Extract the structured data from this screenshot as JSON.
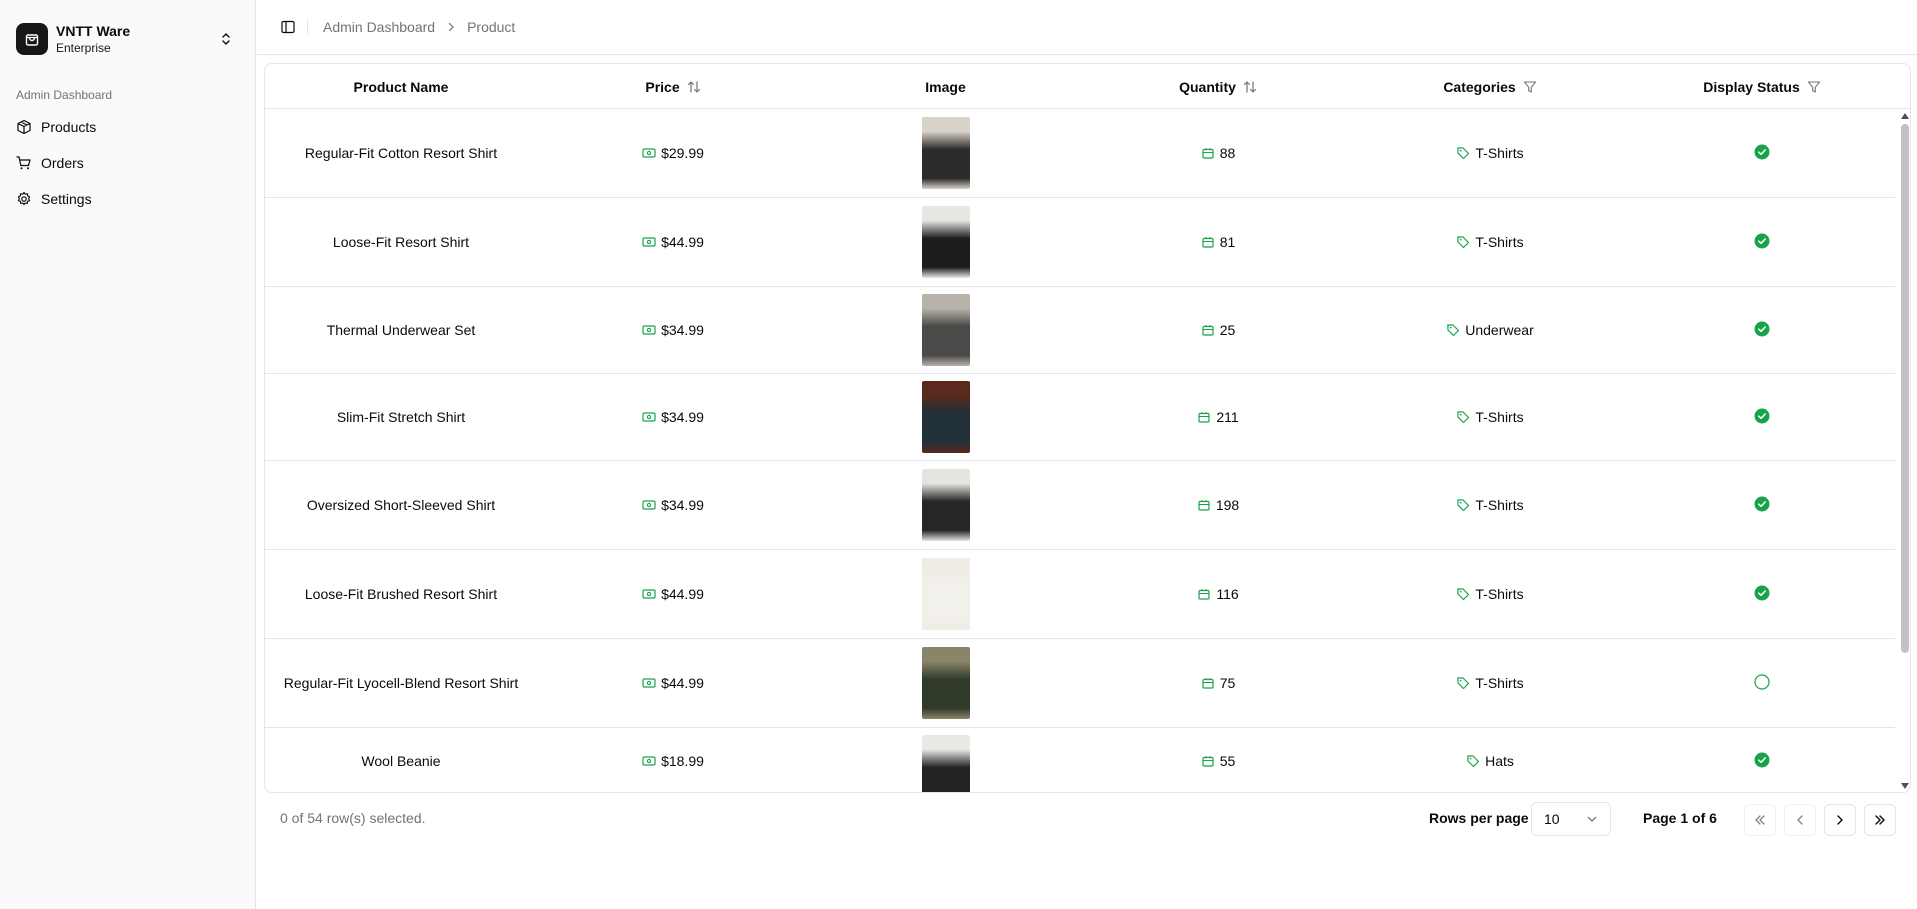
{
  "team": {
    "name": "VNTT Ware",
    "plan": "Enterprise"
  },
  "sidebar": {
    "group_label": "Admin Dashboard",
    "items": [
      {
        "label": "Products",
        "icon": "package-icon"
      },
      {
        "label": "Orders",
        "icon": "shopping-cart-icon"
      },
      {
        "label": "Settings",
        "icon": "gear-icon"
      }
    ]
  },
  "breadcrumb": {
    "root": "Admin Dashboard",
    "current": "Product"
  },
  "table": {
    "columns": [
      "Product Name",
      "Price",
      "Image",
      "Quantity",
      "Categories",
      "Display Status"
    ],
    "rows": [
      {
        "name": "Regular-Fit Cotton Resort Shirt",
        "price": "$29.99",
        "quantity": "88",
        "category": "T-Shirts",
        "displayed": true
      },
      {
        "name": "Loose-Fit Resort Shirt",
        "price": "$44.99",
        "quantity": "81",
        "category": "T-Shirts",
        "displayed": true
      },
      {
        "name": "Thermal Underwear Set",
        "price": "$34.99",
        "quantity": "25",
        "category": "Underwear",
        "displayed": true
      },
      {
        "name": "Slim-Fit Stretch Shirt",
        "price": "$34.99",
        "quantity": "211",
        "category": "T-Shirts",
        "displayed": true
      },
      {
        "name": "Oversized Short-Sleeved Shirt",
        "price": "$34.99",
        "quantity": "198",
        "category": "T-Shirts",
        "displayed": true
      },
      {
        "name": "Loose-Fit Brushed Resort Shirt",
        "price": "$44.99",
        "quantity": "116",
        "category": "T-Shirts",
        "displayed": true
      },
      {
        "name": "Regular-Fit Lyocell-Blend Resort Shirt",
        "price": "$44.99",
        "quantity": "75",
        "category": "T-Shirts",
        "displayed": false
      },
      {
        "name": "Wool Beanie",
        "price": "$18.99",
        "quantity": "55",
        "category": "Hats",
        "displayed": true
      }
    ]
  },
  "footer": {
    "selected_text": "0 of 54 row(s) selected.",
    "rows_per_page_label": "Rows per page",
    "rows_per_page_value": "10",
    "page_info": "Page 1 of 6"
  },
  "colors": {
    "accent_green": "#16a34a",
    "border": "#e5e5e5",
    "muted": "#737373"
  }
}
